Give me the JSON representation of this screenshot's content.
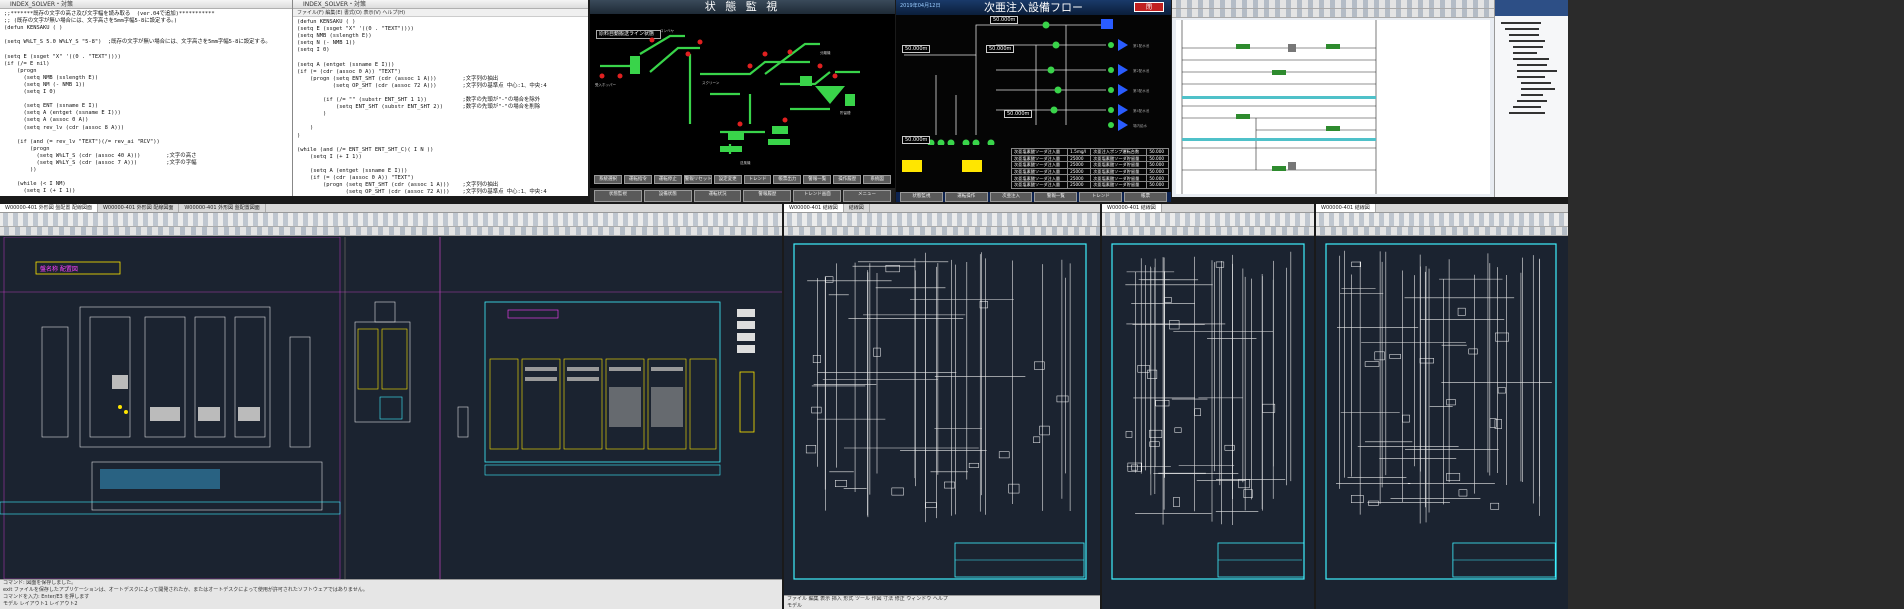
{
  "code_left": {
    "title": "INDEX_SOLVER・対策",
    "lines": [
      ";;*******既存の文字の高さ及び文字幅を読み取る  (ver.04で追加)***********",
      ";; (既存の文字が無い場合には、文字高さを5mm字幅5-8に設定する。)",
      "(defun KENSAKU ( )",
      "",
      "(setq W%LT_S 5.0 W%LY_S \"5-8\")  ;既存の文字が無い場合には、文字高さを5mm字幅5-8に設定する。",
      "",
      "(setq E (ssget \"X\" '((0 . \"TEXT\"))))",
      "(if (/= E nil)",
      "    (progn",
      "      (setq NMB (sslength E))",
      "      (setq NM (- NMB 1))",
      "      (setq I 0)",
      "",
      "      (setq ENT (ssname E I))",
      "      (setq A (entget (ssname E I)))",
      "      (setq A (assoc 0 A))",
      "      (setq rev_lv (cdr (assoc 8 A)))",
      "",
      "    (if (and (= rev_lv \"TEXT\")(/= rev_ai \"RCV\"))",
      "        (progn",
      "          (setq W%LT_S (cdr (assoc 40 A)))        ;文字の高さ",
      "          (setq W%LY_S (cdr (assoc 7 A)))         ;文字の字幅",
      "        ))",
      "",
      "    (while (< I NM)",
      "      (setq I (+ I 1))",
      "",
      "      (setq A (entget (ssname E I)))",
      "",
      "      (if (and (= (cdr (assoc 0 A)) \"TEXT\")(/= (cdr (assoc 1 A)) \"REV\"))",
      "        (progn (setq W%LT_S (cdr (assoc 40 A)))      ;文字の高さ"
    ]
  },
  "code_right": {
    "title": "INDEX_SOLVER・対策",
    "menu": "ファイル(F)  編集(E)  書式(O)  表示(V)  ヘルプ(H)",
    "lines": [
      "(defun KENSAKU ( )",
      "(setq E (ssget \"X\" '((0 . \"TEXT\"))))",
      "(setq NMB (sslength E))",
      "(setq N (- NMB 1))",
      "(setq I 0)",
      "",
      "(setq A (entget (ssname E I)))",
      "(if (= (cdr (assoc 0 A)) \"TEXT\")",
      "    (progn (setq ENT_SHT (cdr (assoc 1 A)))        ;文字列の抽出",
      "           (setq OP_SHT (cdr (assoc 72 A)))        ;文字列の基準点 中心:1、中央:4",
      "",
      "        (if (/= \"\" (substr ENT_SHT 1 1))           ;数字の先頭が\"-\"の場合を除外",
      "            (setq ENT_SHT (substr ENT_SHT 2))      ;数字の先頭が\"-\"の場合を削除",
      "        )",
      "",
      "    )",
      ")",
      "",
      "(while (and (/= ENT_SHT ENT_SHT_C)( I N ))",
      "    (setq I (+ I 1))",
      "",
      "    (setq A (entget (ssname E I)))",
      "    (if (= (cdr (assoc 0 A)) \"TEXT\")",
      "        (progn (setq ENT_SHT (cdr (assoc 1 A)))    ;文字列の抽出",
      "               (setq OP_SHT (cdr (assoc 72 A)))    ;文字列の基準点 中心:1、中央:4",
      "",
      "            (if (/= \"\" (substr ENT_SHT 1 1))",
      "                (setq ENT_SHT (substr ENT_SHT 2))",
      "            )"
    ]
  },
  "scada_status": {
    "title": "状 態 監 視",
    "info_label": "原料自動搬送ライン状態",
    "buttons_row1": [
      "系統選択",
      "運転指令",
      "運転停止",
      "警報リセット",
      "設定変更",
      "トレンド",
      "帳票出力",
      "警報一覧",
      "操作履歴",
      "系統図"
    ],
    "buttons_row2": [
      "状態監視",
      "設備状態",
      "運転状況",
      "警報履歴",
      "トレンド画面",
      "メニュー"
    ]
  },
  "scada_flow": {
    "title": "次亜注入設備フロー",
    "date": "2019年04月12日",
    "close_label": "閉 ",
    "values": [
      "50.000m",
      "50.000m",
      "50.000m",
      "50.000m",
      "50.000m"
    ],
    "table_rows": [
      [
        "次亜塩素酸ソーダ注入量",
        "1.5mg/l",
        "次亜注入ポンプ運転台数",
        "50.000"
      ],
      [
        "次亜塩素酸ソーダ注入量",
        "25000",
        "次亜塩素酸ソーダ貯留量",
        "50.000"
      ],
      [
        "次亜塩素酸ソーダ注入量",
        "25000",
        "次亜塩素酸ソーダ貯留量",
        "50.000"
      ],
      [
        "次亜塩素酸ソーダ注入量",
        "25000",
        "次亜塩素酸ソーダ貯留量",
        "50.000"
      ],
      [
        "次亜塩素酸ソーダ注入量",
        "25000",
        "次亜塩素酸ソーダ貯留量",
        "50.000"
      ],
      [
        "次亜塩素酸ソーダ注入量",
        "25000",
        "次亜塩素酸ソーダ貯留量",
        "50.000"
      ]
    ],
    "bottom_tabs": [
      "状態監視",
      "運転操作",
      "次亜注入",
      "警報一覧",
      "トレンド",
      "帳票"
    ]
  },
  "cad_left": {
    "tabs": [
      "W00000-401 外形図 盤配置 配線図面",
      "W00000-401 外形図 配線図面",
      "W00000-401 外形図 盤配置図面"
    ],
    "panel_label": "盤名称 配置図",
    "status_lines": [
      "コマンド: 図面を保存しました。",
      "exit ファイルを保存したアプリケーションは、オートデスクによって開発されたか、またはオートデスクによって使用が許可されたソフトウェアではありません。",
      "コマンドを入力: Enter/E3 を押します",
      "モデル  レイアウト1  レイアウト2"
    ]
  },
  "cad_right": {
    "tabs": [
      "W00000-401 結線図",
      "結線図"
    ],
    "status_lines": [
      "ファイル  編集  表示  挿入  形式  ツール  作図  寸法  修正  ウィンドウ  ヘルプ",
      "モデル"
    ]
  },
  "cad_extra_tabs": {
    "tab_a": "W00000-401 結線図",
    "tab_b": "W00000-401 結線図"
  },
  "colors": {
    "cad_bg": "#1b2330",
    "scada_green": "#39d44a",
    "flow_blue": "#2a5cff",
    "accent_yellow": "#ffe600",
    "accent_magenta": "#ff40ff",
    "accent_cyan": "#3ff0ff"
  }
}
